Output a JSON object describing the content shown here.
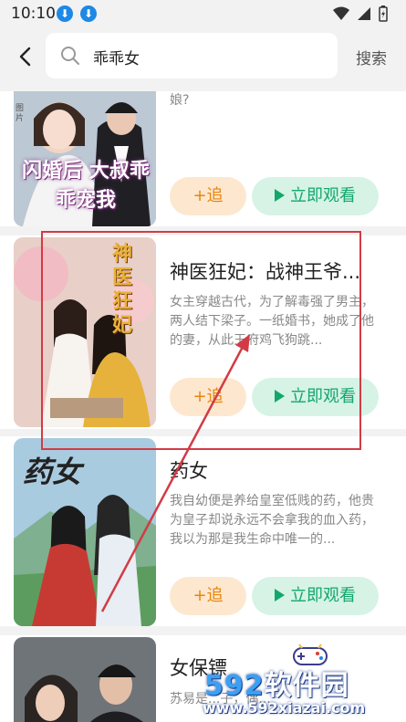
{
  "status_bar": {
    "time": "10:10",
    "download_glyph": "⬇"
  },
  "search": {
    "query": "乖乖女",
    "search_button": "搜索"
  },
  "actions": {
    "follow_plus": "+",
    "follow_label": "追",
    "watch_label": "立即观看"
  },
  "items": [
    {
      "title": "",
      "desc": "娘?",
      "cover_text": "闪婚后 大叔乖乖宠我",
      "cover_tag": "图片"
    },
    {
      "title": "神医狂妃：战神王爷...",
      "desc": "女主穿越古代，为了解毒强了男主，两人结下梁子。一纸婚书，她成了他的妻，从此王府鸡飞狗跳...",
      "cover_text": "神医狂妃"
    },
    {
      "title": "药女",
      "desc": "我自幼便是养给皇室低贱的药，他贵为皇子却说永远不会拿我的血入药，我以为那是我生命中唯一的...",
      "cover_text": "药女"
    },
    {
      "title": "女保镖",
      "desc": "苏易是...子，偶...",
      "cover_text": ""
    }
  ],
  "watermark": {
    "brand_num": "592",
    "brand_text": "软件园",
    "url": "www.592xiazai.com"
  },
  "colors": {
    "accent_green": "#13a76b",
    "accent_orange": "#e8850c",
    "annotation_red": "#d23b45"
  }
}
